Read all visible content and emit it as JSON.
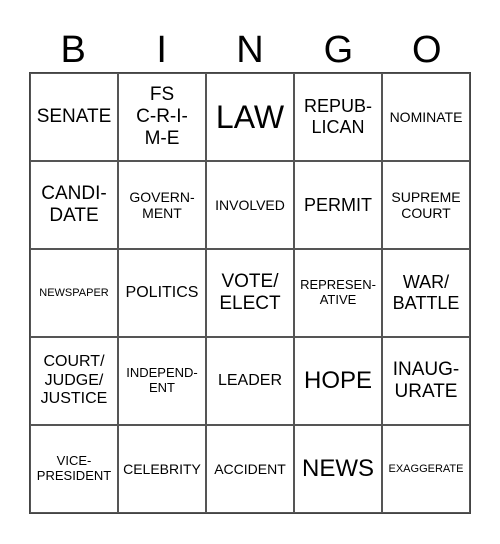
{
  "header": [
    "B",
    "I",
    "N",
    "G",
    "O"
  ],
  "cells": [
    [
      "SENATE",
      "FS\nC-R-I-\nM-E",
      "LAW",
      "REPUB-\nLICAN",
      "NOMINATE"
    ],
    [
      "CANDI-\nDATE",
      "GOVERN-\nMENT",
      "INVOLVED",
      "PERMIT",
      "SUPREME\nCOURT"
    ],
    [
      "NEWSPAPER",
      "POLITICS",
      "VOTE/\nELECT",
      "REPRESEN-\nATIVE",
      "WAR/\nBATTLE"
    ],
    [
      "COURT/\nJUDGE/\nJUSTICE",
      "INDEPEND-\nENT",
      "LEADER",
      "HOPE",
      "INAUG-\nURATE"
    ],
    [
      "VICE-\nPRESIDENT",
      "CELEBRITY",
      "ACCIDENT",
      "NEWS",
      "EXAGGERATE"
    ]
  ]
}
